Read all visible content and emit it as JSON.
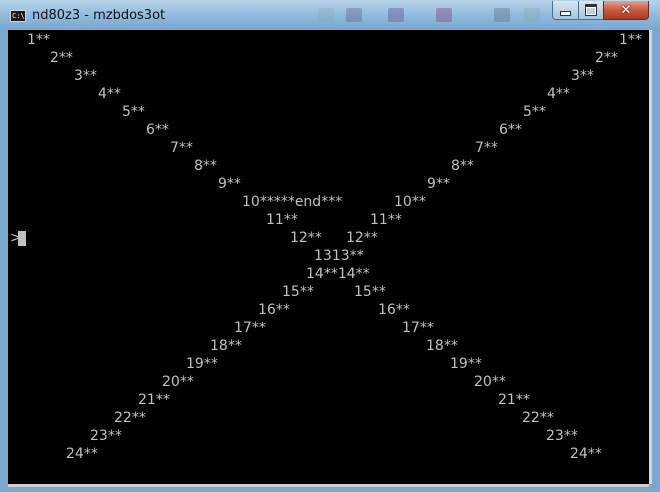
{
  "window": {
    "title": "nd80z3 - mzbdos3ot",
    "icon_label": "C:\\",
    "controls": {
      "minimize": "minimize",
      "maximize": "maximize",
      "close": "✕"
    }
  },
  "console": {
    "prompt": ">",
    "lines": [
      {
        "left": "1**",
        "right": "1**"
      },
      {
        "left": "2**",
        "right": "2**"
      },
      {
        "left": "3**",
        "right": "3**"
      },
      {
        "left": "4**",
        "right": "4**"
      },
      {
        "left": "5**",
        "right": "5**"
      },
      {
        "left": "6**",
        "right": "6**"
      },
      {
        "left": "7**",
        "right": "7**"
      },
      {
        "left": "8**",
        "right": "8**"
      },
      {
        "left": "9**",
        "right": "9**"
      },
      {
        "left": "10*****end***",
        "right": "10**"
      },
      {
        "left": "11**",
        "right": "11**"
      },
      {
        "left": "12**",
        "right": "12**"
      },
      {
        "left": "1313**",
        "right": ""
      },
      {
        "left": "14**14**",
        "right": ""
      },
      {
        "left": "15**",
        "right": "15**"
      },
      {
        "left": "16**",
        "right": "16**"
      },
      {
        "left": "17**",
        "right": "17**"
      },
      {
        "left": "18**",
        "right": "18**"
      },
      {
        "left": "19**",
        "right": "19**"
      },
      {
        "left": "20**",
        "right": "20**"
      },
      {
        "left": "21**",
        "right": "21**"
      },
      {
        "left": "22**",
        "right": "22**"
      },
      {
        "left": "23**",
        "right": "23**"
      },
      {
        "left": "24**",
        "right": "24**"
      }
    ]
  },
  "colors": {
    "text": "#c0c0c0",
    "background": "#000000"
  }
}
